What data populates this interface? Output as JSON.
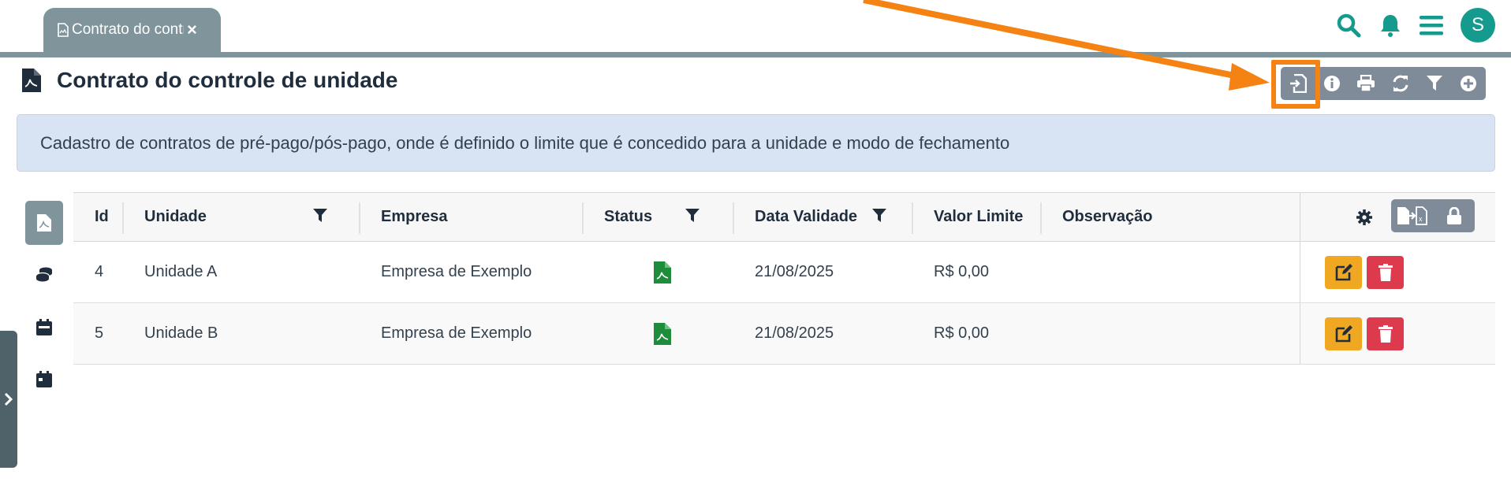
{
  "tab": {
    "label": "Contrato do controle de unidade",
    "close": "×"
  },
  "header": {
    "avatar_initial": "S"
  },
  "page": {
    "title": "Contrato do controle de unidade",
    "description": "Cadastro de contratos de pré-pago/pós-pago, onde é definido o limite que é concedido para a unidade e modo de fechamento"
  },
  "toolbar": {
    "buttons": [
      "import-icon",
      "info-icon",
      "print-icon",
      "refresh-icon",
      "filter-icon",
      "add-icon"
    ]
  },
  "grid": {
    "columns": [
      "Id",
      "Unidade",
      "Empresa",
      "Status",
      "Data Validade",
      "Valor Limite",
      "Observação"
    ],
    "rows": [
      {
        "id": "4",
        "unidade": "Unidade A",
        "empresa": "Empresa de Exemplo",
        "status": "file-pdf-icon",
        "data_validade": "21/08/2025",
        "valor_limite": "R$ 0,00",
        "observacao": ""
      },
      {
        "id": "5",
        "unidade": "Unidade B",
        "empresa": "Empresa de Exemplo",
        "status": "file-pdf-icon",
        "data_validade": "21/08/2025",
        "valor_limite": "R$ 0,00",
        "observacao": ""
      }
    ]
  },
  "colors": {
    "accent": "#159a8e",
    "tab": "#7f959b",
    "toolbar": "#7f8b99",
    "highlight": "#f48314",
    "edit": "#f0a722",
    "delete": "#de3a4e",
    "status_green": "#1e8c3a"
  }
}
